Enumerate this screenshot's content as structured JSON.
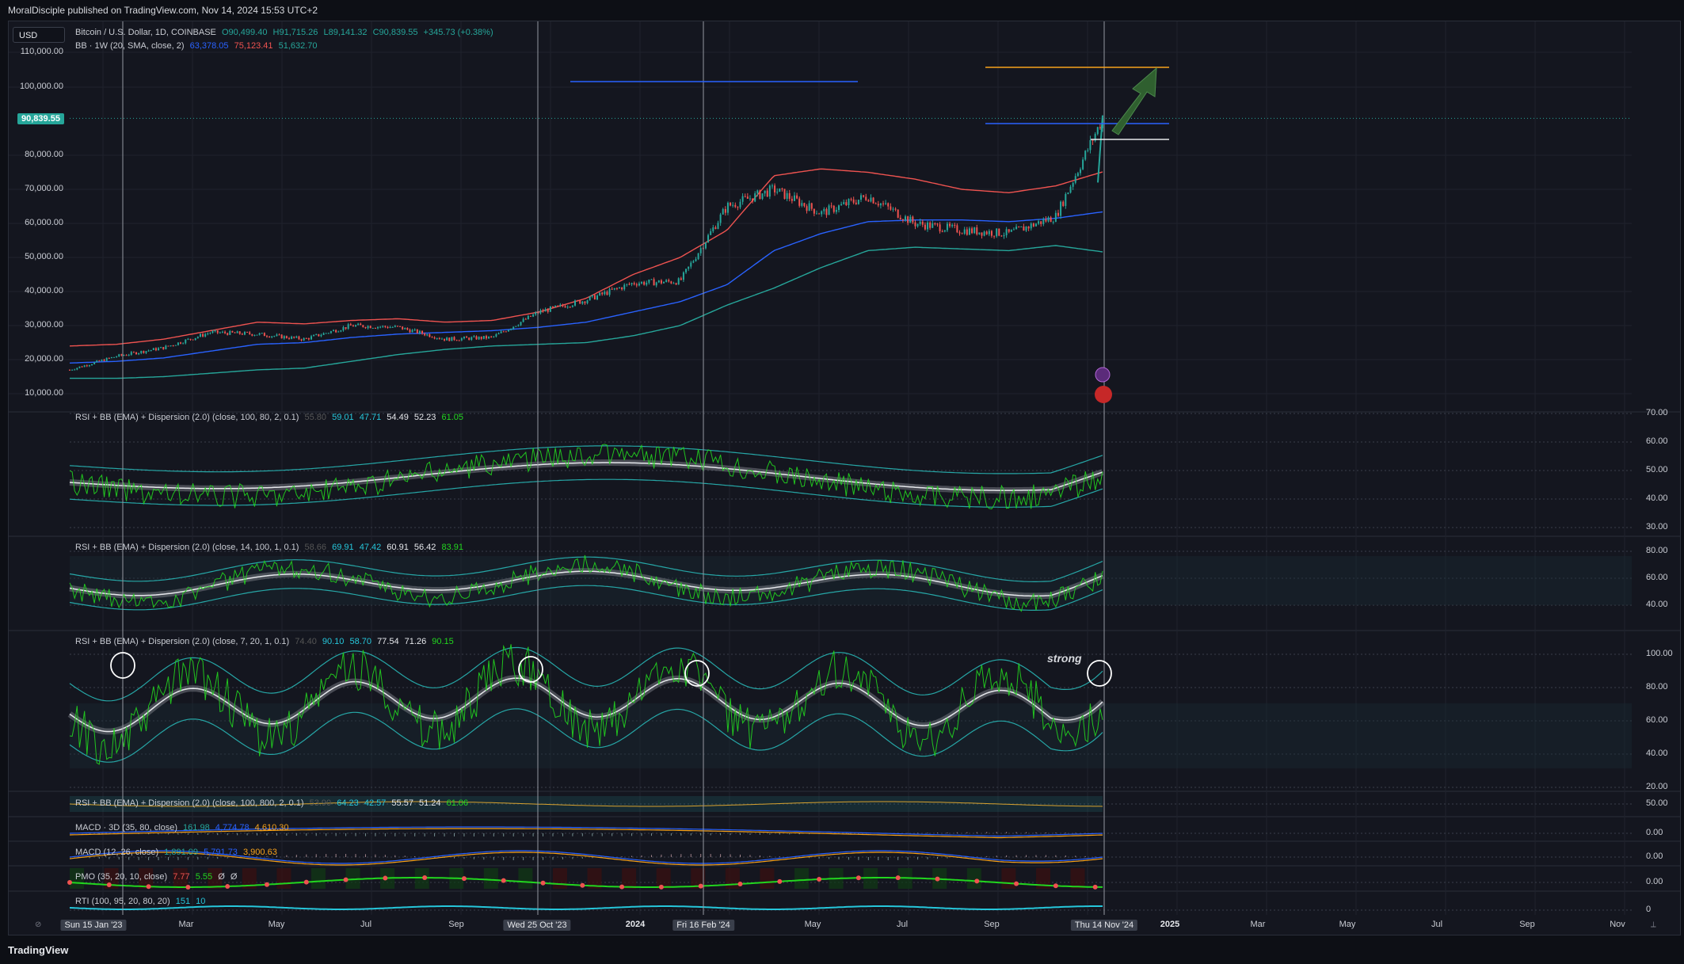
{
  "header": {
    "published": "MoralDisciple published on TradingView.com, Nov 14, 2024 15:53 UTC+2"
  },
  "currency_button": "USD",
  "price_badge": "90,839.55",
  "brand": "TradingView",
  "annotation_text": "strong",
  "legends": {
    "main": {
      "title": "Bitcoin / U.S. Dollar, 1D, COINBASE",
      "o": "O90,499.40",
      "h": "H91,715.26",
      "l": "L89,141.32",
      "c": "C90,839.55",
      "chg": "+345.73 (+0.38%)"
    },
    "bb": {
      "label": "BB · 1W (20, SMA, close, 2)",
      "v1": "63,378.05",
      "v2": "75,123.41",
      "v3": "51,632.70"
    },
    "rsi1": {
      "label": "RSI + BB (EMA) + Dispersion (2.0) (close, 100, 80, 2, 0.1)",
      "v0": "55.80",
      "v1": "59.01",
      "v2": "47.71",
      "v3": "54.49",
      "v4": "52.23",
      "v5": "61.05"
    },
    "rsi2": {
      "label": "RSI + BB (EMA) + Dispersion (2.0) (close, 14, 100, 1, 0.1)",
      "v0": "58.66",
      "v1": "69.91",
      "v2": "47.42",
      "v3": "60.91",
      "v4": "56.42",
      "v5": "83.91"
    },
    "rsi3": {
      "label": "RSI + BB (EMA) + Dispersion (2.0) (close, 7, 20, 1, 0.1)",
      "v0": "74.40",
      "v1": "90.10",
      "v2": "58.70",
      "v3": "77.54",
      "v4": "71.26",
      "v5": "90.15"
    },
    "rsi4": {
      "label": "RSI + BB (EMA) + Dispersion (2.0) (close, 100, 800, 2, 0.1)",
      "v0": "53.90",
      "v1": "64.23",
      "v2": "42.57",
      "v3": "55.57",
      "v4": "51.24",
      "v5": "61.06"
    },
    "macd1": {
      "label": "MACD · 3D (35, 80, close)",
      "v1": "161.98",
      "v2": "4,774.78",
      "v3": "4,610.30"
    },
    "macd2": {
      "label": "MACD (12, 26, close)",
      "v1": "1,891.09",
      "v2": "5,791.73",
      "v3": "3,900.63"
    },
    "pmo": {
      "label": "PMO (35, 20, 10, close)",
      "v1": "7.77",
      "v2": "5.55",
      "v3": "Ø",
      "v4": "Ø"
    },
    "rti": {
      "label": "RTI (100, 95, 20, 80, 20)",
      "v1": "151",
      "v2": "10"
    }
  },
  "price_axis": [
    "110,000.00",
    "100,000.00",
    "80,000.00",
    "70,000.00",
    "60,000.00",
    "50,000.00",
    "40,000.00",
    "30,000.00",
    "20,000.00",
    "10,000.00"
  ],
  "rsi1_axis": [
    "70.00",
    "60.00",
    "50.00",
    "40.00",
    "30.00"
  ],
  "rsi2_axis": [
    "80.00",
    "60.00",
    "40.00"
  ],
  "rsi3_axis": [
    "100.00",
    "80.00",
    "60.00",
    "40.00",
    "20.00"
  ],
  "rsi4_axis": [
    "50.00"
  ],
  "macd1_axis": [
    "0.00"
  ],
  "macd2_axis": [
    "0.00"
  ],
  "pmo_axis": [
    "0.00"
  ],
  "rti_axis": [
    "0"
  ],
  "time_axis": [
    {
      "label": "Sun 15 Jan '23",
      "style": "box"
    },
    {
      "label": "Mar",
      "style": ""
    },
    {
      "label": "May",
      "style": ""
    },
    {
      "label": "Jul",
      "style": ""
    },
    {
      "label": "Sep",
      "style": ""
    },
    {
      "label": "Wed 25 Oct '23",
      "style": "box"
    },
    {
      "label": "2024",
      "style": "bold"
    },
    {
      "label": "Fri 16 Feb '24",
      "style": "box"
    },
    {
      "label": "May",
      "style": ""
    },
    {
      "label": "Jul",
      "style": ""
    },
    {
      "label": "Sep",
      "style": ""
    },
    {
      "label": "Thu 14 Nov '24",
      "style": "box"
    },
    {
      "label": "2025",
      "style": "bold"
    },
    {
      "label": "Mar",
      "style": ""
    },
    {
      "label": "May",
      "style": ""
    },
    {
      "label": "Jul",
      "style": ""
    },
    {
      "label": "Sep",
      "style": ""
    },
    {
      "label": "Nov",
      "style": ""
    }
  ],
  "colors": {
    "up": "#26a69a",
    "down": "#ef5350",
    "bb_upper": "#ef5350",
    "bb_basis": "#2962ff",
    "bb_lower": "#26a69a",
    "rsi_green": "#22d61f",
    "rsi_red": "#d01a1a",
    "band_teal": "#26a6a6",
    "band_gray": "#9598a1",
    "orange": "#f7a21b",
    "blue_line": "#2962ff",
    "arrow": "#2f5f2f"
  },
  "chart_data": {
    "type": "line",
    "title": "Bitcoin / U.S. Dollar, 1D, COINBASE",
    "x": [
      "2023-01",
      "2023-02",
      "2023-03",
      "2023-04",
      "2023-05",
      "2023-06",
      "2023-07",
      "2023-08",
      "2023-09",
      "2023-10",
      "2023-11",
      "2023-12",
      "2024-01",
      "2024-02",
      "2024-03",
      "2024-04",
      "2024-05",
      "2024-06",
      "2024-07",
      "2024-08",
      "2024-09",
      "2024-10",
      "2024-11"
    ],
    "series": [
      {
        "name": "BTCUSD",
        "values": [
          17000,
          21000,
          23500,
          28000,
          27500,
          26000,
          30000,
          29500,
          26000,
          26500,
          34000,
          37500,
          42500,
          43000,
          65000,
          70000,
          63000,
          68000,
          60000,
          58000,
          57000,
          62000,
          90839
        ]
      },
      {
        "name": "BB upper",
        "values": [
          24000,
          24500,
          26000,
          28500,
          31000,
          30500,
          31500,
          32000,
          31000,
          31500,
          34000,
          38000,
          45000,
          50000,
          58000,
          74000,
          76000,
          75000,
          73000,
          70000,
          69000,
          71000,
          75123
        ]
      },
      {
        "name": "BB basis",
        "values": [
          19000,
          19500,
          20500,
          22500,
          24500,
          25000,
          26500,
          27500,
          28000,
          28500,
          29500,
          31000,
          34000,
          37000,
          42000,
          52000,
          57000,
          60500,
          61000,
          61000,
          60500,
          61500,
          63378
        ]
      },
      {
        "name": "BB lower",
        "values": [
          14500,
          14500,
          15000,
          16000,
          17000,
          17500,
          19500,
          21500,
          23000,
          24000,
          24500,
          25000,
          27000,
          30000,
          36000,
          41000,
          47000,
          52000,
          53000,
          52500,
          52000,
          53500,
          51632
        ]
      }
    ],
    "ylim": [
      10000,
      110000
    ],
    "xlabel": "",
    "ylabel": ""
  }
}
